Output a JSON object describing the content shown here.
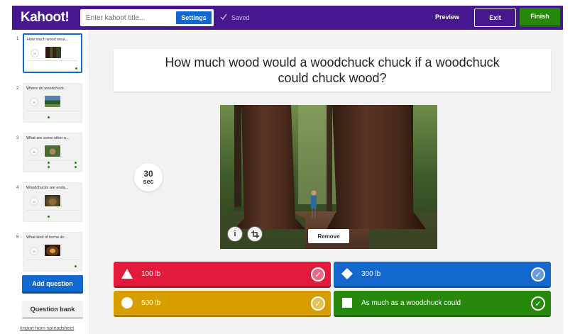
{
  "header": {
    "logo": "Kahoot!",
    "title_placeholder": "Enter kahoot title...",
    "settings_label": "Settings",
    "saved_label": "Saved",
    "preview_label": "Preview",
    "exit_label": "Exit",
    "finish_label": "Finish",
    "colors": {
      "bar": "#46178f",
      "finish": "#26890c",
      "settings": "#1368ce"
    }
  },
  "sidebar": {
    "slides": [
      {
        "number": "1",
        "title": "How much wood woul...",
        "timer": "30",
        "thumb": "forest",
        "active": true
      },
      {
        "number": "2",
        "title": "Where do woodchuck...",
        "timer": "30",
        "thumb": "landscape",
        "active": false
      },
      {
        "number": "3",
        "title": "What are some other n...",
        "timer": "30",
        "thumb": "animal",
        "active": false
      },
      {
        "number": "4",
        "title": "Woodchucks are enda...",
        "timer": "30",
        "thumb": "woodchuck",
        "active": false
      },
      {
        "number": "5",
        "title": "What kind of home do ...",
        "timer": "30",
        "thumb": "burrow",
        "active": false
      }
    ],
    "add_question_label": "Add question",
    "question_bank_label": "Question bank",
    "import_label": "Import from spreadsheet"
  },
  "main": {
    "question": "How much wood would a woodchuck chuck if a woodchuck could chuck wood?",
    "timer_value": "30",
    "timer_unit": "sec",
    "remove_label": "Remove",
    "answers": [
      {
        "shape": "triangle",
        "text": "100 lb",
        "color": "#e21b3c",
        "correct": false
      },
      {
        "shape": "diamond",
        "text": "300 lb",
        "color": "#1368ce",
        "correct": false
      },
      {
        "shape": "circle",
        "text": "500 lb",
        "color": "#d89e00",
        "correct": false
      },
      {
        "shape": "square",
        "text": "As much as a woodchuck could",
        "color": "#26890c",
        "correct": true
      }
    ]
  }
}
